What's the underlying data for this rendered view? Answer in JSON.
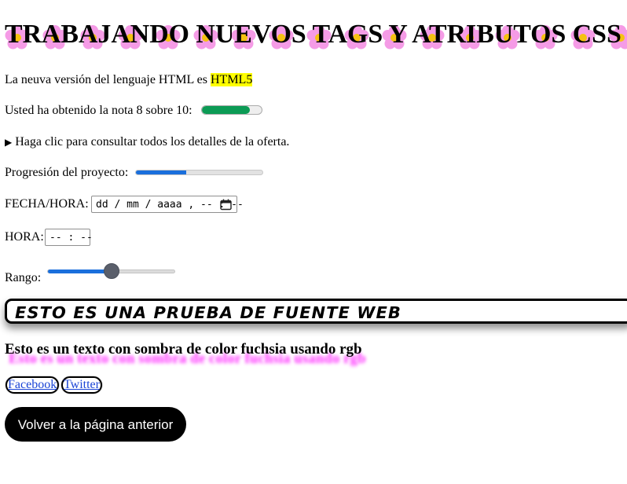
{
  "title": "TRABAJANDO NUEVOS TAGS Y ATRIBUTOS CSS",
  "html_version": {
    "prefix": "La neuva versión del lenguaje HTML es",
    "highlight": "HTML5"
  },
  "grade": {
    "label": "Usted ha obtenido la nota 8 sobre 10:",
    "value": 8,
    "max": 10,
    "color": "#0c9b55"
  },
  "details": {
    "marker": "▶",
    "summary": "Haga clic para consultar todos los detalles de la oferta."
  },
  "project_progress": {
    "label": "Progresión del proyecto:",
    "fraction": 0.4,
    "color": "#1a6fdc"
  },
  "datetime": {
    "label": "FECHA/HORA:",
    "placeholder": "dd / mm / aaaa ,  -- : --",
    "icon": "calendar-icon"
  },
  "time": {
    "label": "HORA:",
    "placeholder": "-- : --"
  },
  "range": {
    "label": "Rango:",
    "fraction": 0.5
  },
  "webfont_text": "ESTO ES UNA PRUEBA DE FUENTE WEB",
  "shadow_text": "Esto es un texto con sombra de color fuchsia usando rgb",
  "social": {
    "facebook": "Facebook",
    "twitter": "Twitter"
  },
  "back_button": "Volver a la página anterior",
  "colors": {
    "highlight": "#ffff00",
    "button_bg": "#000000",
    "shadow": "#ff00ff"
  }
}
